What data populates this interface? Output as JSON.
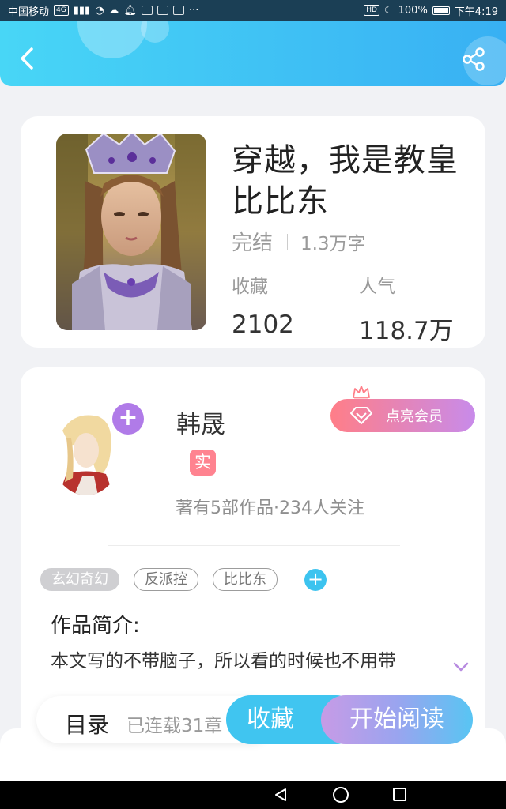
{
  "status_bar": {
    "carrier": "中国移动",
    "network": "4G",
    "battery": "100%",
    "time": "下午4:19"
  },
  "header": {
    "back_icon": "chevron-left-icon",
    "share_icon": "share-icon"
  },
  "book": {
    "title": "穿越，我是教皇比比东",
    "status": "完结",
    "word_count": "1.3万字",
    "favorites_label": "收藏",
    "favorites_value": "2102",
    "popularity_label": "人气",
    "popularity_value": "118.7万"
  },
  "author": {
    "name": "韩晟",
    "verified_badge": "实",
    "stats": "著有5部作品·234人关注",
    "vip_button": "点亮会员"
  },
  "tags": [
    "玄幻奇幻",
    "反派控",
    "比比东"
  ],
  "intro": {
    "title": "作品简介:",
    "text": "本文写的不带脑子，所以看的时候也不用带"
  },
  "bottom": {
    "catalog_label": "目录",
    "serial_status": "已连载31章",
    "collect_button": "收藏",
    "read_button": "开始阅读"
  },
  "colors": {
    "header_start": "#48d6f6",
    "header_end": "#38b0f3",
    "accent_purple": "#b07be8",
    "vip_pink": "#ff7e88",
    "collect_blue": "#40c5f0"
  }
}
